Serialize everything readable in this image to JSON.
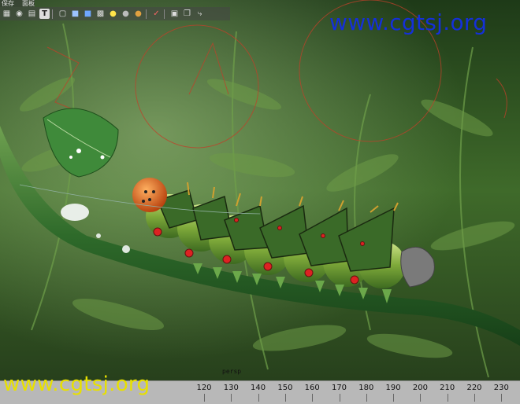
{
  "menu": {
    "items": [
      "保存",
      "面板"
    ]
  },
  "toolbar": {
    "icons": [
      "grid-icon",
      "camera-icon",
      "wireframe-icon",
      "text-icon",
      "cube-icon",
      "shaded-cube-icon",
      "textured-cube-icon",
      "checker-icon",
      "light-icon",
      "sphere-icon",
      "material-sphere-icon",
      "select-icon",
      "isolate-icon",
      "layers-icon",
      "share-icon"
    ],
    "text_icon_glyph": "T"
  },
  "watermark": {
    "top": "www.cgtsj.org",
    "bottom": "www.cgtsj.org"
  },
  "viewport": {
    "camera": "persp"
  },
  "timeline": {
    "ticks": [
      "120",
      "130",
      "140",
      "150",
      "160",
      "170",
      "180",
      "190",
      "200",
      "210",
      "220",
      "230"
    ]
  },
  "colors": {
    "watermark_top": "#1430d8",
    "watermark_bottom": "#e8e000",
    "timeline_bg": "#b8b8b8"
  }
}
